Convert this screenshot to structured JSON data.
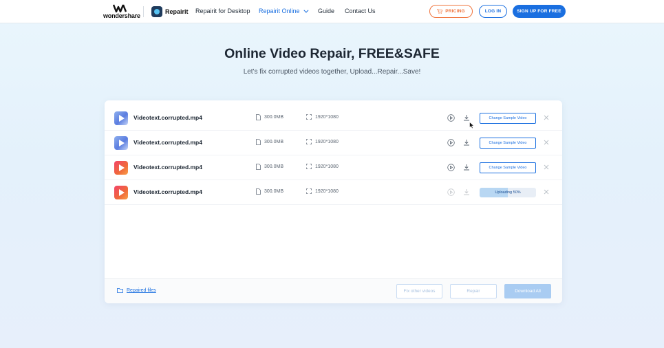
{
  "nav": {
    "brand": "wondershare",
    "product": "Repairit",
    "links": [
      "Repairit for Desktop",
      "Repairit Online",
      "Guide",
      "Contact Us"
    ],
    "pricing": "PRICING",
    "login": "LOG IN",
    "signup": "SIGN UP FOR FREE"
  },
  "hero": {
    "title": "Online Video Repair, FREE&SAFE",
    "subtitle": "Let's fix corrupted videos together, Upload...Repair...Save!"
  },
  "files": [
    {
      "name": "Videotext.corrupted.mp4",
      "size": "300.0MB",
      "resolution": "1920*1080",
      "thumb": "blue",
      "action": "Change Sample Video"
    },
    {
      "name": "Videotext.corrupted.mp4",
      "size": "300.0MB",
      "resolution": "1920*1080",
      "thumb": "blue",
      "action": "Change Sample Video"
    },
    {
      "name": "Videotext.corrupted.mp4",
      "size": "300.0MB",
      "resolution": "1920*1080",
      "thumb": "red",
      "action": "Change Sample Video"
    },
    {
      "name": "Videotext.corrupted.mp4",
      "size": "300.0MB",
      "resolution": "1920*1080",
      "thumb": "red",
      "upload_status": "Uploading 50%",
      "upload_progress": 0.5
    }
  ],
  "footer": {
    "repaired_files": "Repaired files",
    "fix_other": "Fix other videos",
    "repair": "Repair",
    "download_all": "Download All"
  },
  "colors": {
    "accent": "#1a6fe0",
    "pricing": "#f0733b",
    "disabled_fill": "#a9ccf2"
  }
}
